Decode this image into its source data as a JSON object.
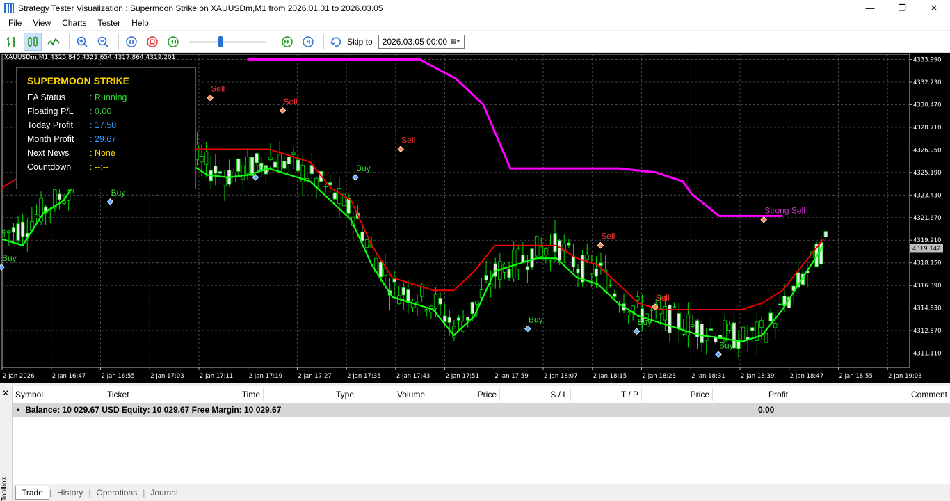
{
  "window": {
    "title": "Strategy Tester Visualization : Supermoon Strike on XAUUSDm,M1 from 2026.01.01 to 2026.03.05",
    "minimize": "—",
    "restore": "❐",
    "close": "✕"
  },
  "menu": [
    "File",
    "View",
    "Charts",
    "Tester",
    "Help"
  ],
  "toolbar": {
    "skip_label": "Skip to",
    "skip_value": "2026.03.05 00:00",
    "speed_fraction": 0.4
  },
  "chart": {
    "header": "XAUUSDm,M1   4320.840 4321.654 4317.864 4319.201",
    "current_price": "4319.142",
    "panel": {
      "title": "SUPERMOON STRIKE",
      "rows": [
        {
          "label": "EA Status",
          "value": ": Running",
          "color": "#33dd33"
        },
        {
          "label": "Floating P/L",
          "value": ": 0.00",
          "color": "#33dd33"
        },
        {
          "label": "Today Profit",
          "value": ": 17.50",
          "color": "#3399ff"
        },
        {
          "label": "Month Profit",
          "value": ": 29.67",
          "color": "#3399ff"
        },
        {
          "label": "Next News",
          "value": ": None",
          "color": "#ffd700"
        },
        {
          "label": "Countdown",
          "value": ": --:--",
          "color": "#ffd700"
        }
      ]
    }
  },
  "chart_data": {
    "type": "candlestick",
    "symbol": "XAUUSDm",
    "timeframe": "M1",
    "y_ticks": [
      "4333.990",
      "4332.230",
      "4330.470",
      "4328.710",
      "4326.950",
      "4325.190",
      "4323.430",
      "4321.670",
      "4319.910",
      "4318.150",
      "4316.390",
      "4314.630",
      "4312.870",
      "4311.110"
    ],
    "ylim": [
      4310.0,
      4334.4
    ],
    "x_ticks": [
      "2 Jan 2026",
      "2 Jan 16:47",
      "2 Jan 16:55",
      "2 Jan 17:03",
      "2 Jan 17:11",
      "2 Jan 17:19",
      "2 Jan 17:27",
      "2 Jan 17:35",
      "2 Jan 17:43",
      "2 Jan 17:51",
      "2 Jan 17:59",
      "2 Jan 18:07",
      "2 Jan 18:15",
      "2 Jan 18:23",
      "2 Jan 18:31",
      "2 Jan 18:39",
      "2 Jan 18:47",
      "2 Jan 18:55",
      "2 Jan 19:03"
    ],
    "trend_line": [
      4320.5,
      4321.0,
      4322.4,
      4323.7,
      4326.0,
      4328.5,
      4330.2,
      4329.7,
      4328.5,
      4326.8,
      4325.5,
      4325.0,
      4325.6,
      4326.3,
      4325.8,
      4324.8,
      4323.5,
      4322.0,
      4318.8,
      4316.1,
      4315.7,
      4315.0,
      4313.0,
      4315.0,
      4317.5,
      4318.2,
      4319.2,
      4319.5,
      4317.8,
      4317.5,
      4315.5,
      4314.3,
      4314.0,
      4313.5,
      4313.0,
      4312.7,
      4312.2,
      4312.8,
      4314.8,
      4317.3,
      4319.6
    ],
    "line_green": [
      4320.0,
      4319.5,
      4322.0,
      4323.0,
      4325.5,
      4328.0,
      4328.5,
      4328.5,
      4327.5,
      4326.0,
      4325.0,
      4324.8,
      4325.0,
      4325.5,
      4325.0,
      4324.5,
      4323.0,
      4321.5,
      4318.0,
      4315.5,
      4315.0,
      4314.5,
      4312.5,
      4314.0,
      4317.5,
      4318.0,
      4318.5,
      4318.5,
      4317.0,
      4316.5,
      4315.0,
      4314.0,
      4313.5,
      4313.0,
      4312.5,
      4312.3,
      4312.0,
      4312.5,
      4314.5,
      4317.0,
      4319.5
    ],
    "line_red": [
      4324.0,
      4325.0,
      4326.0,
      4327.0,
      4328.5,
      4330.5,
      4330.5,
      4330.0,
      4329.0,
      4327.0,
      4327.0,
      4327.0,
      4327.0,
      4327.0,
      4326.5,
      4326.0,
      4324.0,
      4323.0,
      4319.5,
      4317.0,
      4316.5,
      4316.0,
      4316.0,
      4317.5,
      4319.5,
      4319.5,
      4319.5,
      4319.5,
      4318.5,
      4318.0,
      4316.5,
      4315.0,
      4314.5,
      4314.5,
      4314.5,
      4314.5,
      4314.5,
      4315.0,
      4316.0,
      4318.0,
      4320.0
    ],
    "series": [
      {
        "name": "EMA",
        "color": "#ff00ff",
        "values": [
          [
            0.27,
            4334.0
          ],
          [
            0.46,
            4334.0
          ],
          [
            0.5,
            4332.5
          ],
          [
            0.53,
            4330.5
          ],
          [
            0.56,
            4325.5
          ],
          [
            0.68,
            4325.5
          ],
          [
            0.72,
            4325.2
          ],
          [
            0.75,
            4324.5
          ],
          [
            0.76,
            4323.5
          ],
          [
            0.79,
            4321.8
          ],
          [
            0.86,
            4321.8
          ]
        ]
      }
    ],
    "signals": [
      {
        "text": "Sell",
        "color": "#ff3333",
        "x": 0.23,
        "y": 4331.5
      },
      {
        "text": "Sell",
        "color": "#ff3333",
        "x": 0.17,
        "y": 4329.7
      },
      {
        "text": "Sell",
        "color": "#ff3333",
        "x": 0.31,
        "y": 4330.5
      },
      {
        "text": "Sell",
        "color": "#ff3333",
        "x": 0.44,
        "y": 4327.5
      },
      {
        "text": "Sell",
        "color": "#ff3333",
        "x": 0.07,
        "y": 4325.9
      },
      {
        "text": "Sell",
        "color": "#ff3333",
        "x": 0.66,
        "y": 4320.0
      },
      {
        "text": "Sell",
        "color": "#ff3333",
        "x": 0.72,
        "y": 4315.2
      },
      {
        "text": "Buy",
        "color": "#33dd33",
        "x": 0.12,
        "y": 4323.4
      },
      {
        "text": "Buy",
        "color": "#33dd33",
        "x": 0.28,
        "y": 4325.3
      },
      {
        "text": "Buy",
        "color": "#33dd33",
        "x": 0.39,
        "y": 4325.3
      },
      {
        "text": "Buy",
        "color": "#33dd33",
        "x": 0.58,
        "y": 4313.5
      },
      {
        "text": "Buy",
        "color": "#33dd33",
        "x": 0.7,
        "y": 4313.3
      },
      {
        "text": "Buy",
        "color": "#33dd33",
        "x": 0.79,
        "y": 4311.5
      },
      {
        "text": "Buy",
        "color": "#33dd33",
        "x": 0.0,
        "y": 4318.3
      },
      {
        "text": "Strong Sell",
        "color": "#cc33cc",
        "x": 0.84,
        "y": 4322.0
      }
    ],
    "bid_line": 4319.3,
    "grid": true
  },
  "toolbox": {
    "close": "✕",
    "label": "Toolbox",
    "columns": [
      "Symbol",
      "Ticket",
      "Time",
      "Type",
      "Volume",
      "Price",
      "S / L",
      "T / P",
      "Price",
      "Profit",
      "Comment"
    ],
    "balance_text": "Balance: 10 029.67 USD  Equity: 10 029.67  Free Margin: 10 029.67",
    "balance_profit": "0.00",
    "tabs": [
      "Trade",
      "History",
      "Operations",
      "Journal"
    ]
  }
}
